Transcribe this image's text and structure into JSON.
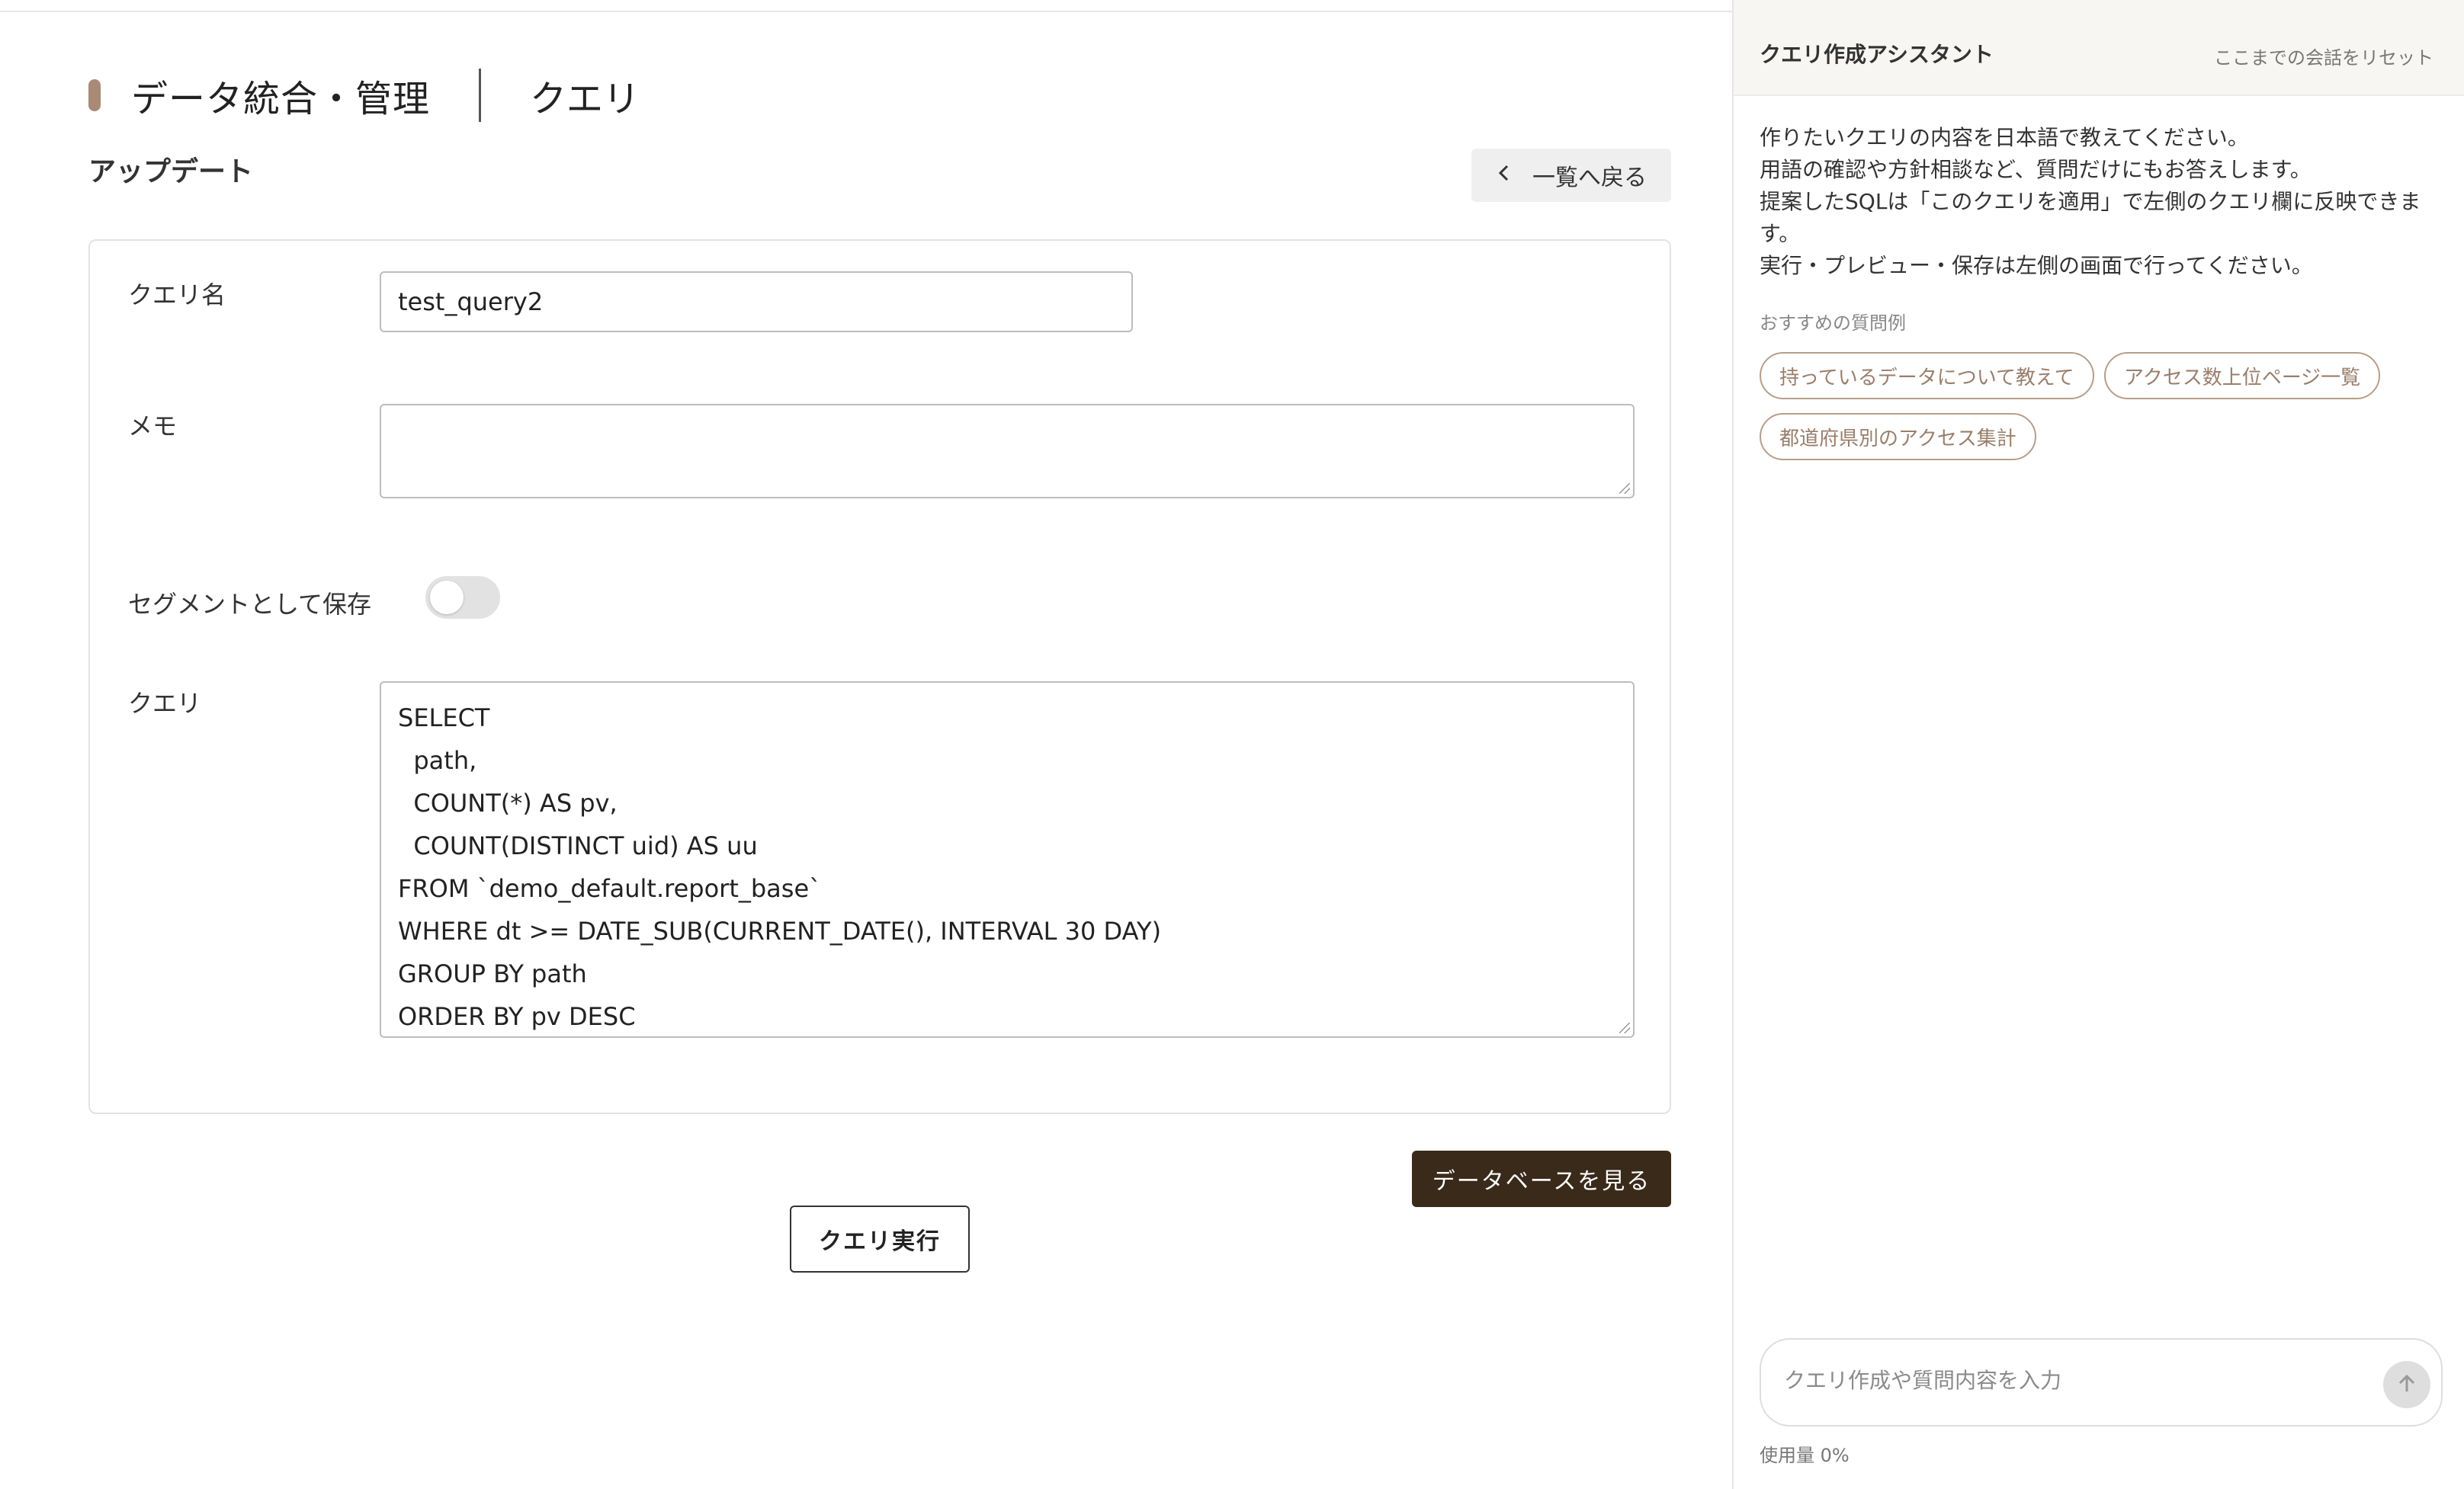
{
  "header": {
    "title": "データ統合・管理",
    "subtitle": "クエリ"
  },
  "section": {
    "title": "アップデート",
    "back_label": "一覧へ戻る"
  },
  "form": {
    "query_name_label": "クエリ名",
    "query_name_value": "test_query2",
    "memo_label": "メモ",
    "memo_value": "",
    "segment_label": "セグメントとして保存",
    "segment_enabled": false,
    "query_label": "クエリ",
    "query_lines": [
      "SELECT",
      "  path,",
      "  COUNT(*) AS pv,",
      "  COUNT(DISTINCT uid) AS uu",
      "FROM `demo_default.report_base`",
      "WHERE dt >= DATE_SUB(CURRENT_DATE(), INTERVAL 30 DAY)",
      "GROUP BY path",
      "ORDER BY pv DESC"
    ]
  },
  "actions": {
    "view_database_label": "データベースを見る",
    "run_query_label": "クエリ実行"
  },
  "assistant": {
    "title": "クエリ作成アシスタント",
    "reset_label": "ここまでの会話をリセット",
    "intro_lines": [
      "作りたいクエリの内容を日本語で教えてください。",
      "用語の確認や方針相談など、質問だけにもお答えします。",
      "提案したSQLは「このクエリを適用」で左側のクエリ欄に反映できま",
      "す。",
      "実行・プレビュー・保存は左側の画面で行ってください。"
    ],
    "suggestions_label": "おすすめの質問例",
    "suggestions": [
      "持っているデータについて教えて",
      "アクセス数上位ページ一覧",
      "都道府県別のアクセス集計"
    ],
    "input_placeholder": "クエリ作成や質問内容を入力",
    "usage": "使用量 0%"
  },
  "colors": {
    "accent": "#a88a76",
    "primary_button": "#3a2a1a",
    "chip_border": "#b89d87",
    "chip_text": "#9a7e6a"
  },
  "icons": {
    "back": "chevron-left-icon",
    "send": "arrow-up-icon"
  }
}
